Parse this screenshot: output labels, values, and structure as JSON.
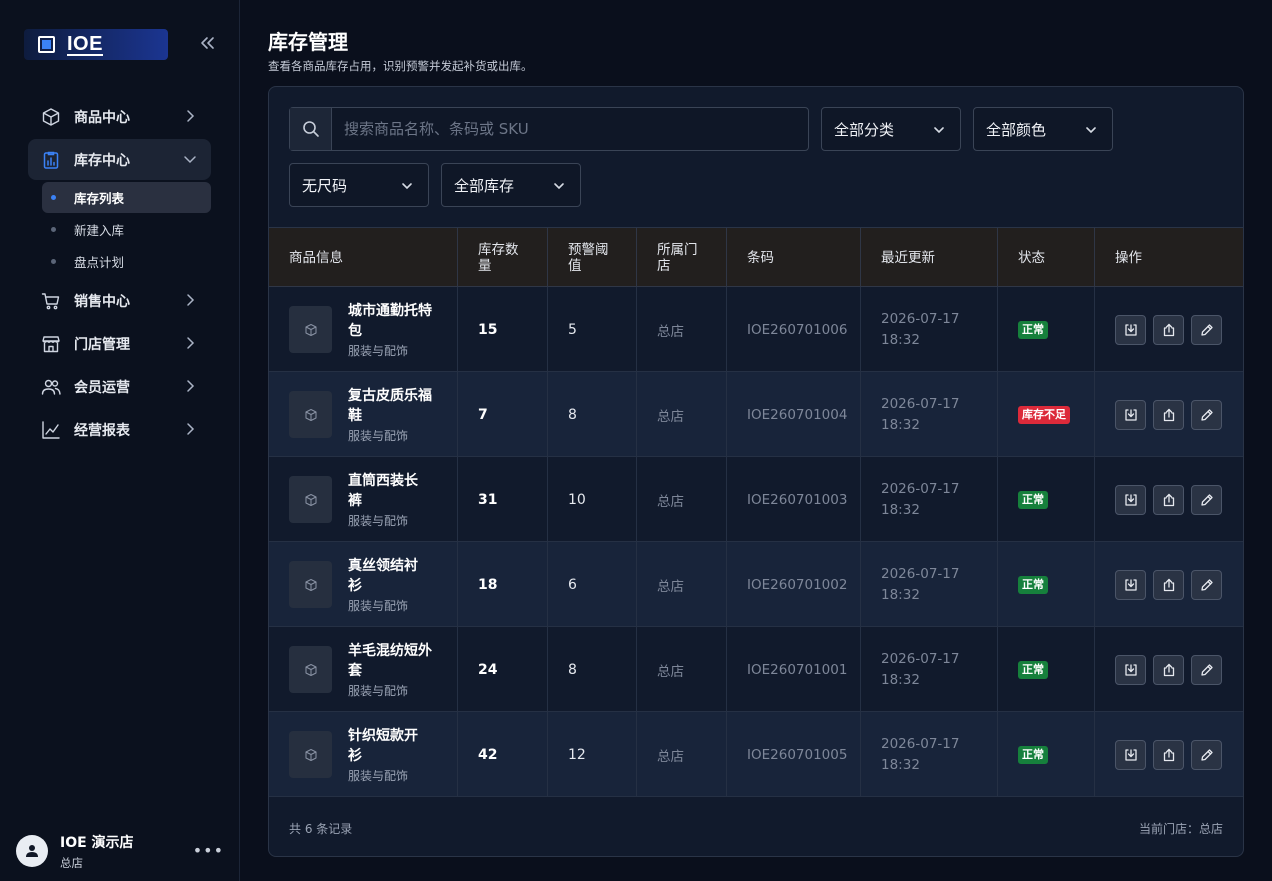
{
  "brand": {
    "name": "IOE"
  },
  "sidebar": {
    "items": [
      {
        "label": "商品中心",
        "icon": "box-icon"
      },
      {
        "label": "库存中心",
        "icon": "clipboard-chart-icon",
        "active": true,
        "children": [
          {
            "label": "库存列表",
            "active": true
          },
          {
            "label": "新建入库"
          },
          {
            "label": "盘点计划"
          }
        ]
      },
      {
        "label": "销售中心",
        "icon": "cart-icon"
      },
      {
        "label": "门店管理",
        "icon": "store-icon"
      },
      {
        "label": "会员运营",
        "icon": "users-icon"
      },
      {
        "label": "经营报表",
        "icon": "line-chart-icon"
      }
    ]
  },
  "user": {
    "name": "IOE 演示店",
    "store": "总店",
    "more": "•••"
  },
  "page": {
    "title": "库存管理",
    "description": "查看各商品库存占用，识别预警并发起补货或出库。"
  },
  "filters": {
    "search_placeholder": "搜索商品名称、条码或 SKU",
    "category": "全部分类",
    "color": "全部颜色",
    "size": "无尺码",
    "stock": "全部库存"
  },
  "table": {
    "headers": {
      "product": "商品信息",
      "qty": "库存数量",
      "threshold": "预警阈值",
      "store": "所属门店",
      "barcode": "条码",
      "updated": "最近更新",
      "status": "状态",
      "actions": "操作"
    },
    "rows": [
      {
        "name": "城市通勤托特包",
        "category": "服装与配饰",
        "qty": "15",
        "threshold": "5",
        "store": "总店",
        "barcode": "IOE260701006",
        "date": "2026-07-17",
        "time": "18:32",
        "status": "正常",
        "status_type": "ok"
      },
      {
        "name": "复古皮质乐福鞋",
        "category": "服装与配饰",
        "qty": "7",
        "threshold": "8",
        "store": "总店",
        "barcode": "IOE260701004",
        "date": "2026-07-17",
        "time": "18:32",
        "status": "库存不足",
        "status_type": "low"
      },
      {
        "name": "直筒西装长裤",
        "category": "服装与配饰",
        "qty": "31",
        "threshold": "10",
        "store": "总店",
        "barcode": "IOE260701003",
        "date": "2026-07-17",
        "time": "18:32",
        "status": "正常",
        "status_type": "ok"
      },
      {
        "name": "真丝领结衬衫",
        "category": "服装与配饰",
        "qty": "18",
        "threshold": "6",
        "store": "总店",
        "barcode": "IOE260701002",
        "date": "2026-07-17",
        "time": "18:32",
        "status": "正常",
        "status_type": "ok"
      },
      {
        "name": "羊毛混纺短外套",
        "category": "服装与配饰",
        "qty": "24",
        "threshold": "8",
        "store": "总店",
        "barcode": "IOE260701001",
        "date": "2026-07-17",
        "time": "18:32",
        "status": "正常",
        "status_type": "ok"
      },
      {
        "name": "针织短款开衫",
        "category": "服装与配饰",
        "qty": "42",
        "threshold": "12",
        "store": "总店",
        "barcode": "IOE260701005",
        "date": "2026-07-17",
        "time": "18:32",
        "status": "正常",
        "status_type": "ok"
      }
    ]
  },
  "footer": {
    "count": "共 6 条记录",
    "current_store": "当前门店：总店"
  }
}
